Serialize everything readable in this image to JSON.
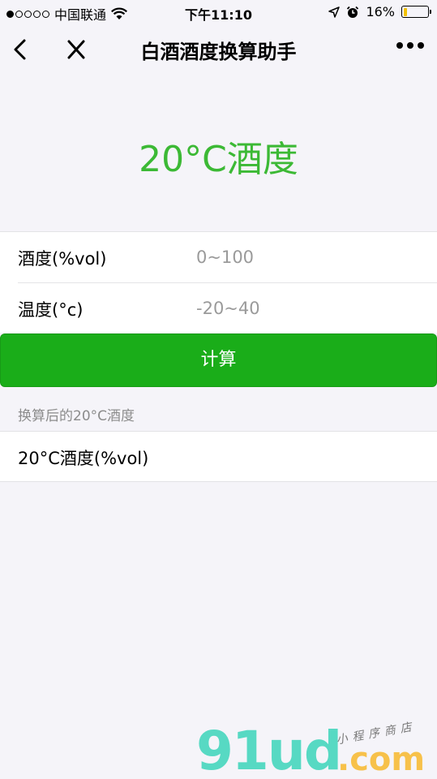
{
  "status_bar": {
    "carrier": "中国联通",
    "time": "下午11:10",
    "battery_percent": "16%",
    "battery_level": 0.16,
    "signal_bars_filled": 1,
    "signal_bars_total": 5,
    "icons": [
      "wifi-icon",
      "location-arrow-icon",
      "alarm-icon",
      "battery-icon"
    ]
  },
  "nav": {
    "title": "白酒酒度换算助手",
    "icons": [
      "back-chevron-icon",
      "close-icon",
      "more-dots-icon"
    ]
  },
  "result_headline": "20°C酒度",
  "form": {
    "abv": {
      "label": "酒度(%vol)",
      "placeholder": "0~100",
      "value": ""
    },
    "temperature": {
      "label": "温度(°c)",
      "placeholder": "-20~40",
      "value": ""
    }
  },
  "calc_button_label": "计算",
  "result": {
    "caption": "换算后的20°C酒度",
    "label": "20°C酒度(%vol)"
  },
  "watermark": {
    "main": "91ud",
    "tld": ".com",
    "sub": "小程序商店"
  },
  "colors": {
    "accent_green": "#1aad19",
    "headline_green": "#3cb935",
    "background": "#f5f4f9",
    "battery_yellow": "#f2c100"
  }
}
